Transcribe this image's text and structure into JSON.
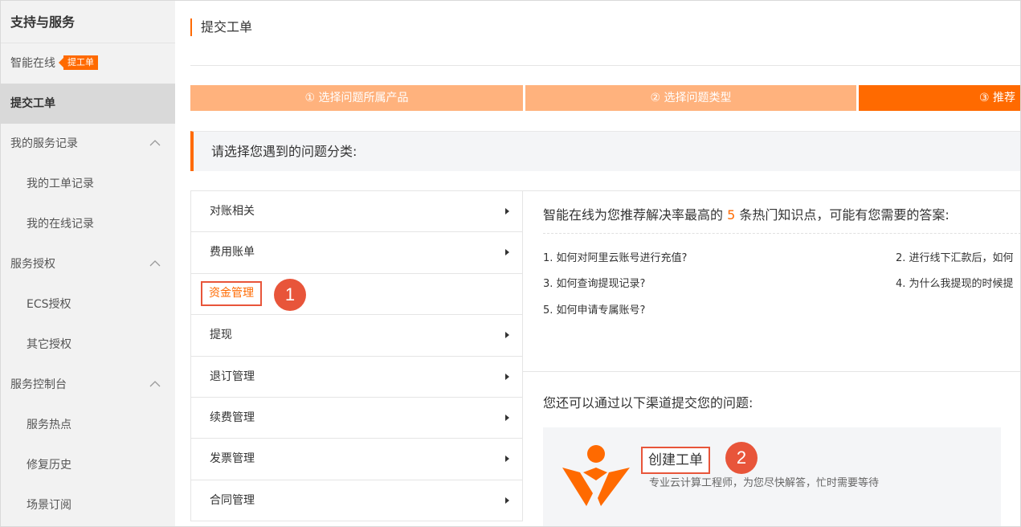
{
  "sidebar": {
    "title": "支持与服务",
    "online": {
      "label": "智能在线",
      "badge": "提工单"
    },
    "submit": "提交工单",
    "groups": [
      {
        "label": "我的服务记录",
        "items": [
          "我的工单记录",
          "我的在线记录"
        ]
      },
      {
        "label": "服务授权",
        "items": [
          "ECS授权",
          "其它授权"
        ]
      },
      {
        "label": "服务控制台",
        "items": [
          "服务热点",
          "修复历史",
          "场景订阅"
        ]
      }
    ]
  },
  "main": {
    "title": "提交工单",
    "steps": [
      "① 选择问题所属产品",
      "② 选择问题类型",
      "③ 推荐"
    ],
    "prompt": "请选择您遇到的问题分类:",
    "categories": [
      "对账相关",
      "费用账单",
      "资金管理",
      "提现",
      "退订管理",
      "续费管理",
      "发票管理",
      "合同管理"
    ],
    "selected_category": "资金管理",
    "callout_1": "1",
    "kb": {
      "head_pre": "智能在线为您推荐解决率最高的 ",
      "head_num": "5",
      "head_post": " 条热门知识点，可能有您需要的答案:",
      "links": [
        "1. 如何对阿里云账号进行充值?",
        "2. 进行线下汇款后，如何",
        "3. 如何查询提现记录?",
        "4. 为什么我提现的时候提",
        "5. 如何申请专属账号?"
      ]
    },
    "channels": {
      "head": "您还可以通过以下渠道提交您的问题:",
      "card": {
        "title": "创建工单",
        "desc": "专业云计算工程师，为您尽快解答，忙时需要等待",
        "callout": "2"
      }
    }
  },
  "colors": {
    "accent": "#ff6a00",
    "step_light": "#ffb27d",
    "highlight_red": "#e8553a"
  }
}
